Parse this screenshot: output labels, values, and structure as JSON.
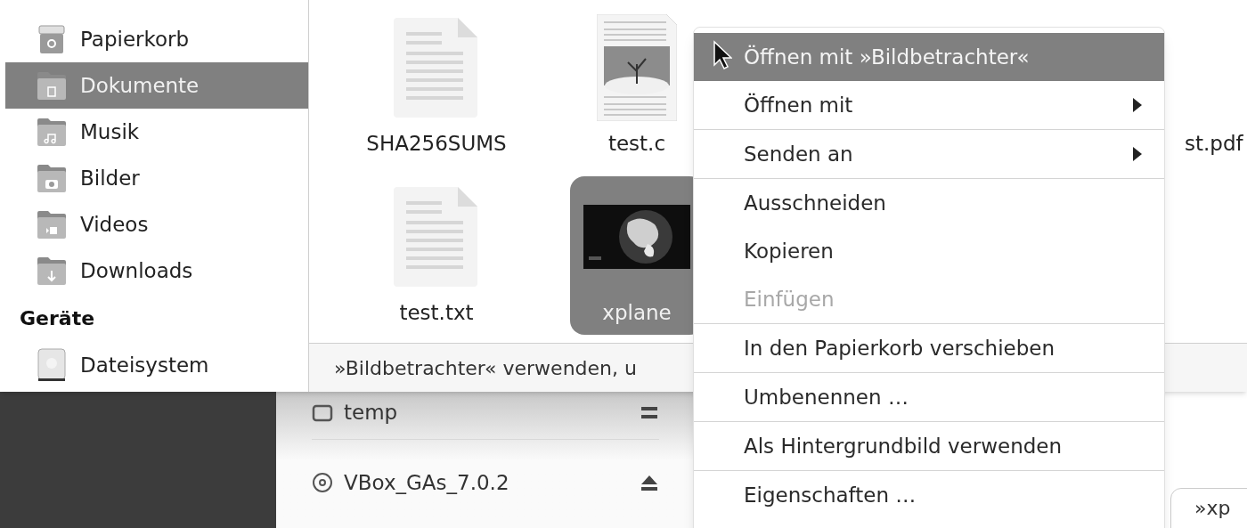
{
  "sidebar": {
    "items": [
      {
        "kind": "place",
        "label": "Papierkorb",
        "selected": false
      },
      {
        "kind": "place",
        "label": "Dokumente",
        "selected": true
      },
      {
        "kind": "place",
        "label": "Musik",
        "selected": false
      },
      {
        "kind": "place",
        "label": "Bilder",
        "selected": false
      },
      {
        "kind": "place",
        "label": "Videos",
        "selected": false
      },
      {
        "kind": "place",
        "label": "Downloads",
        "selected": false
      },
      {
        "kind": "header",
        "label": "Geräte"
      },
      {
        "kind": "place",
        "label": "Dateisystem",
        "selected": false
      }
    ]
  },
  "files": [
    {
      "name": "SHA256SUMS",
      "selected": false
    },
    {
      "name": "test.c",
      "selected": false
    },
    {
      "name": "st.pdf",
      "selected": false
    },
    {
      "name": "test.txt",
      "selected": false
    },
    {
      "name": "xplane",
      "selected": true
    }
  ],
  "status_bar": "»Bildbetrachter« verwenden, u",
  "volumes": [
    {
      "name": "temp"
    },
    {
      "name": "VBox_GAs_7.0.2"
    }
  ],
  "context_menu": [
    {
      "kind": "item",
      "label": "Öffnen mit »Bildbetrachter«",
      "selected": true,
      "disabled": false,
      "submenu": false
    },
    {
      "kind": "item",
      "label": "Öffnen mit",
      "selected": false,
      "disabled": false,
      "submenu": true
    },
    {
      "kind": "separator"
    },
    {
      "kind": "item",
      "label": "Senden an",
      "selected": false,
      "disabled": false,
      "submenu": true
    },
    {
      "kind": "separator"
    },
    {
      "kind": "item",
      "label": "Ausschneiden",
      "selected": false,
      "disabled": false,
      "submenu": false
    },
    {
      "kind": "item",
      "label": "Kopieren",
      "selected": false,
      "disabled": false,
      "submenu": false
    },
    {
      "kind": "item",
      "label": "Einfügen",
      "selected": false,
      "disabled": true,
      "submenu": false
    },
    {
      "kind": "separator"
    },
    {
      "kind": "item",
      "label": "In den Papierkorb verschieben",
      "selected": false,
      "disabled": false,
      "submenu": false
    },
    {
      "kind": "separator"
    },
    {
      "kind": "item",
      "label": "Umbenennen …",
      "selected": false,
      "disabled": false,
      "submenu": false
    },
    {
      "kind": "separator"
    },
    {
      "kind": "item",
      "label": "Als Hintergrundbild verwenden",
      "selected": false,
      "disabled": false,
      "submenu": false
    },
    {
      "kind": "separator"
    },
    {
      "kind": "item",
      "label": "Eigenschaften …",
      "selected": false,
      "disabled": false,
      "submenu": false
    }
  ],
  "tooltip": "»xp"
}
